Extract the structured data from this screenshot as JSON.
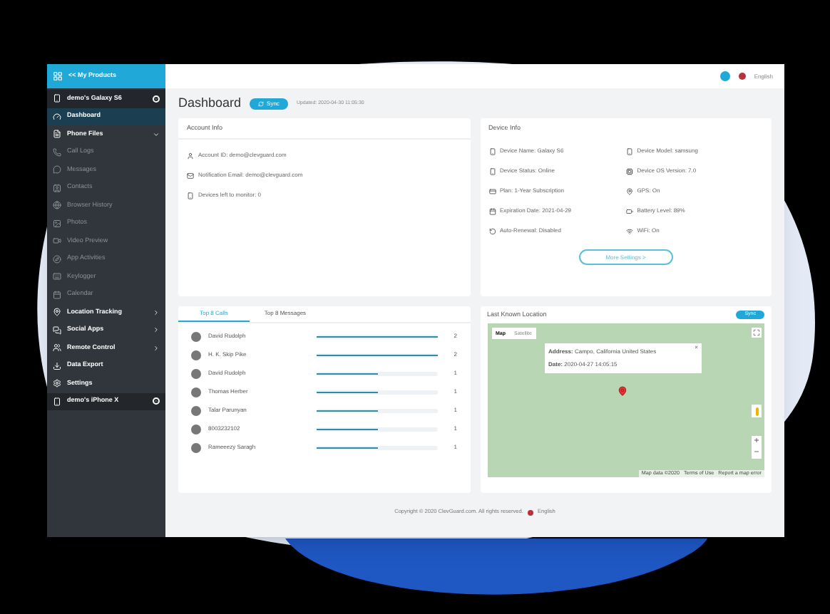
{
  "sidebar": {
    "header": "<< My Products",
    "items": [
      {
        "kind": "device",
        "label": "demo's Galaxy S6",
        "expanded": true,
        "selected": false
      },
      {
        "kind": "item",
        "label": "Dashboard",
        "selected": true
      },
      {
        "kind": "group",
        "label": "Phone Files",
        "expanded": true,
        "selected": false
      },
      {
        "kind": "sub",
        "label": "Call Logs",
        "selected": false
      },
      {
        "kind": "sub",
        "label": "Messages",
        "selected": false
      },
      {
        "kind": "sub",
        "label": "Contacts",
        "selected": false
      },
      {
        "kind": "sub",
        "label": "Browser History",
        "selected": false
      },
      {
        "kind": "sub",
        "label": "Photos",
        "selected": false
      },
      {
        "kind": "sub",
        "label": "Video Preview",
        "selected": false
      },
      {
        "kind": "sub",
        "label": "App Activities",
        "selected": false
      },
      {
        "kind": "sub",
        "label": "Keylogger",
        "selected": false
      },
      {
        "kind": "sub",
        "label": "Calendar",
        "selected": false
      },
      {
        "kind": "group",
        "label": "Location Tracking",
        "expanded": false,
        "selected": false
      },
      {
        "kind": "group",
        "label": "Social Apps",
        "expanded": false,
        "selected": false
      },
      {
        "kind": "group",
        "label": "Remote Control",
        "expanded": false,
        "selected": false
      },
      {
        "kind": "item",
        "label": "Data Export",
        "selected": false
      },
      {
        "kind": "item",
        "label": "Settings",
        "selected": false
      },
      {
        "kind": "device",
        "label": "demo's iPhone X",
        "expanded": false,
        "selected": false
      }
    ]
  },
  "topbar": {
    "language": "English"
  },
  "page": {
    "title": "Dashboard",
    "sync": "Sync",
    "updated": "Updated: 2020-04-30 11:05:30"
  },
  "account_info": {
    "title": "Account Info",
    "rows": [
      "Account ID: demo@clevguard.com",
      "Notification Email: demo@clevguard.com",
      "Devices left to monitor: 0"
    ]
  },
  "device_info": {
    "title": "Device Info",
    "rows": [
      "Device Name: Galaxy S6",
      "Device Model: samsung",
      "Device Status: Online",
      "Device OS Version: 7.0",
      "Plan: 1-Year Subscription",
      "GPS: On",
      "Expiration Date: 2021-04-29",
      "Battery Level: 89%",
      "Auto-Renewal: Disabled",
      "WiFi: On"
    ],
    "button": "More Settings >"
  },
  "top_lists": {
    "tabs": [
      {
        "label": "Top 8 Calls",
        "selected": true
      },
      {
        "label": "Top 8 Messages",
        "selected": false
      }
    ],
    "rows": [
      {
        "name": "David Rudolph",
        "count": "2",
        "level": 1
      },
      {
        "name": "H. K. Skip Pike",
        "count": "2",
        "level": 1
      },
      {
        "name": "David Rudolph",
        "count": "1",
        "level": 0.5
      },
      {
        "name": "Thomas Herber",
        "count": "1",
        "level": 0.5
      },
      {
        "name": "Talar Parunyan",
        "count": "1",
        "level": 0.5
      },
      {
        "name": "8003232102",
        "count": "1",
        "level": 0.5
      },
      {
        "name": "Rameeezy Saragh",
        "count": "1",
        "level": 0.5
      }
    ]
  },
  "location": {
    "title": "Last Known Location",
    "sync": "Sync",
    "map_tabs": [
      {
        "label": "Map",
        "selected": true
      },
      {
        "label": "Satellite",
        "selected": false
      }
    ],
    "popup": {
      "close": "×",
      "address_label": "Address:",
      "address": "Campo, California United States",
      "date_label": "Date:",
      "date": "2020-04-27 14:05:15"
    },
    "attribution": [
      "Map data ©2020",
      "Terms of Use",
      "Report a map error"
    ],
    "zoom_in": "+",
    "zoom_out": "−"
  },
  "footer": {
    "copyright": "Copyright © 2020 ClevGuard.com. All rights reserved.",
    "language": "English"
  }
}
